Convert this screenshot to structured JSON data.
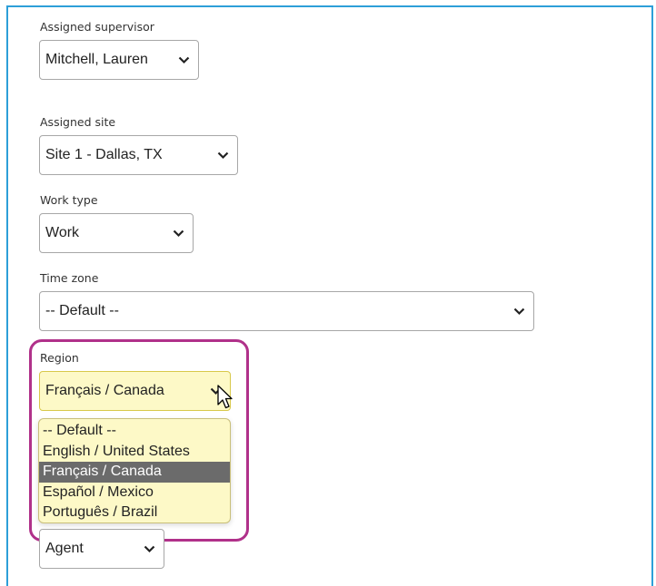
{
  "form": {
    "supervisor": {
      "label": "Assigned supervisor",
      "value": "Mitchell, Lauren"
    },
    "site": {
      "label": "Assigned site",
      "value": "Site 1 - Dallas, TX"
    },
    "work_type": {
      "label": "Work type",
      "value": "Work"
    },
    "time_zone": {
      "label": "Time zone",
      "value": "-- Default --"
    },
    "region": {
      "label": "Region",
      "value": "Français / Canada",
      "options": [
        {
          "label": "-- Default --",
          "selected": false
        },
        {
          "label": "English / United States",
          "selected": false
        },
        {
          "label": "Français / Canada",
          "selected": true
        },
        {
          "label": "Español / Mexico",
          "selected": false
        },
        {
          "label": "Português / Brazil",
          "selected": false
        }
      ]
    },
    "role": {
      "value": "Agent"
    }
  },
  "colors": {
    "frame_border": "#2d9fd8",
    "highlight_ring": "#b0318a",
    "dropdown_background": "#fdf9c7",
    "selected_option": "#6b6b6b"
  },
  "icons": [
    "chevron-down-icon",
    "mouse-pointer-icon"
  ]
}
